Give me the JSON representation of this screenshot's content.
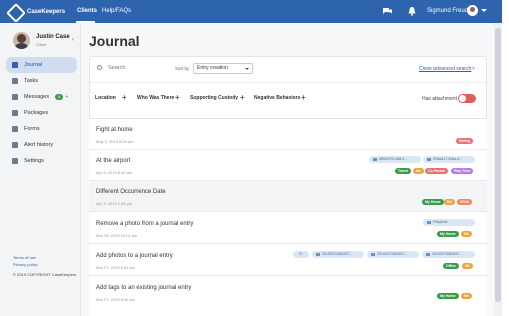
{
  "topbar": {
    "brand": "CaseKeepers",
    "nav": {
      "clients": "Clients",
      "help": "Help/FAQs"
    },
    "user_name": "Sigmund Freud",
    "icons": [
      "chat-icon",
      "bell-icon",
      "avatar",
      "chevron-down-icon"
    ]
  },
  "sidebar": {
    "user": {
      "name": "Justin Case",
      "role": "Client"
    },
    "items": [
      {
        "label": "Journal",
        "icon": "journal-icon",
        "active": true
      },
      {
        "label": "Tasks",
        "icon": "tasks-icon"
      },
      {
        "label": "Messages",
        "icon": "messages-icon",
        "badge": "6"
      },
      {
        "label": "Packages",
        "icon": "packages-icon"
      },
      {
        "label": "Forms",
        "icon": "forms-icon"
      },
      {
        "label": "Alert history",
        "icon": "alert-icon"
      },
      {
        "label": "Settings",
        "icon": "settings-icon"
      }
    ],
    "footer": {
      "terms": "Terms of use",
      "privacy": "Privacy policy",
      "copyright": "© 2019 COPYRIGHT CaseKeepers"
    }
  },
  "main": {
    "title": "Journal",
    "search_placeholder": "Search",
    "sort_label": "Sort by",
    "sort_value": "Entry creation",
    "advanced_link": "Close advanced search",
    "filters": [
      "Location",
      "Who Was There",
      "Supporting Custody",
      "Negative Behaviors"
    ],
    "has_attachment_label": "Has attachment",
    "entries": [
      {
        "title": "Fight at home",
        "date": "May 3, 2019 8:00 am",
        "attachments": [],
        "tags": [
          {
            "label": "Hiding",
            "color": "#e57373"
          }
        ]
      },
      {
        "title": "At the airport",
        "date": "Apr 8, 2019 6:49 am",
        "attachments": [
          "df620970-4c6f-4...",
          "f33ad117-5dea-4..."
        ],
        "tags": [
          {
            "label": "Travel",
            "color": "#3a9b4b"
          },
          {
            "label": "Me",
            "color": "#f0a23b"
          },
          {
            "label": "Co-Parent",
            "color": "#e57373"
          },
          {
            "label": "Play Time",
            "color": "#b57edc"
          }
        ]
      },
      {
        "title": "Different Occurrence Date",
        "date": "Apr 3, 2019 1:26 pm",
        "attachments": [],
        "tags": [
          {
            "label": "My Home",
            "color": "#3a9b4b"
          },
          {
            "label": "Me",
            "color": "#f0a23b"
          },
          {
            "label": "Child",
            "color": "#f08a5d"
          }
        ]
      },
      {
        "title": "Remove a photo from a journal entry",
        "date": "Mar 28, 2019 10:02 pm",
        "attachments": [
          "Pdaytime"
        ],
        "tags": [
          {
            "label": "My Home",
            "color": "#3a9b4b"
          },
          {
            "label": "Me",
            "color": "#f0a23b"
          }
        ]
      },
      {
        "title": "Add photos to a journal entry",
        "date": "Mar 27, 2019 8:53 pm",
        "attachments": [
          "5+",
          "20190370083257...",
          "20190270083257...",
          "20190270083257..."
        ],
        "tags": [
          {
            "label": "Office",
            "color": "#3a9b4b"
          },
          {
            "label": "Me",
            "color": "#f0a23b"
          }
        ]
      },
      {
        "title": "Add tags to an existing journal entry",
        "date": "Mar 27, 2019 8:48 pm",
        "attachments": [],
        "tags": [
          {
            "label": "My Home",
            "color": "#3a9b4b"
          },
          {
            "label": "Me",
            "color": "#f0a23b"
          }
        ]
      }
    ]
  },
  "colors": {
    "brand": "#2d64ad",
    "active_bg": "#d0dcef",
    "toggle_off": "#e15c5c"
  }
}
